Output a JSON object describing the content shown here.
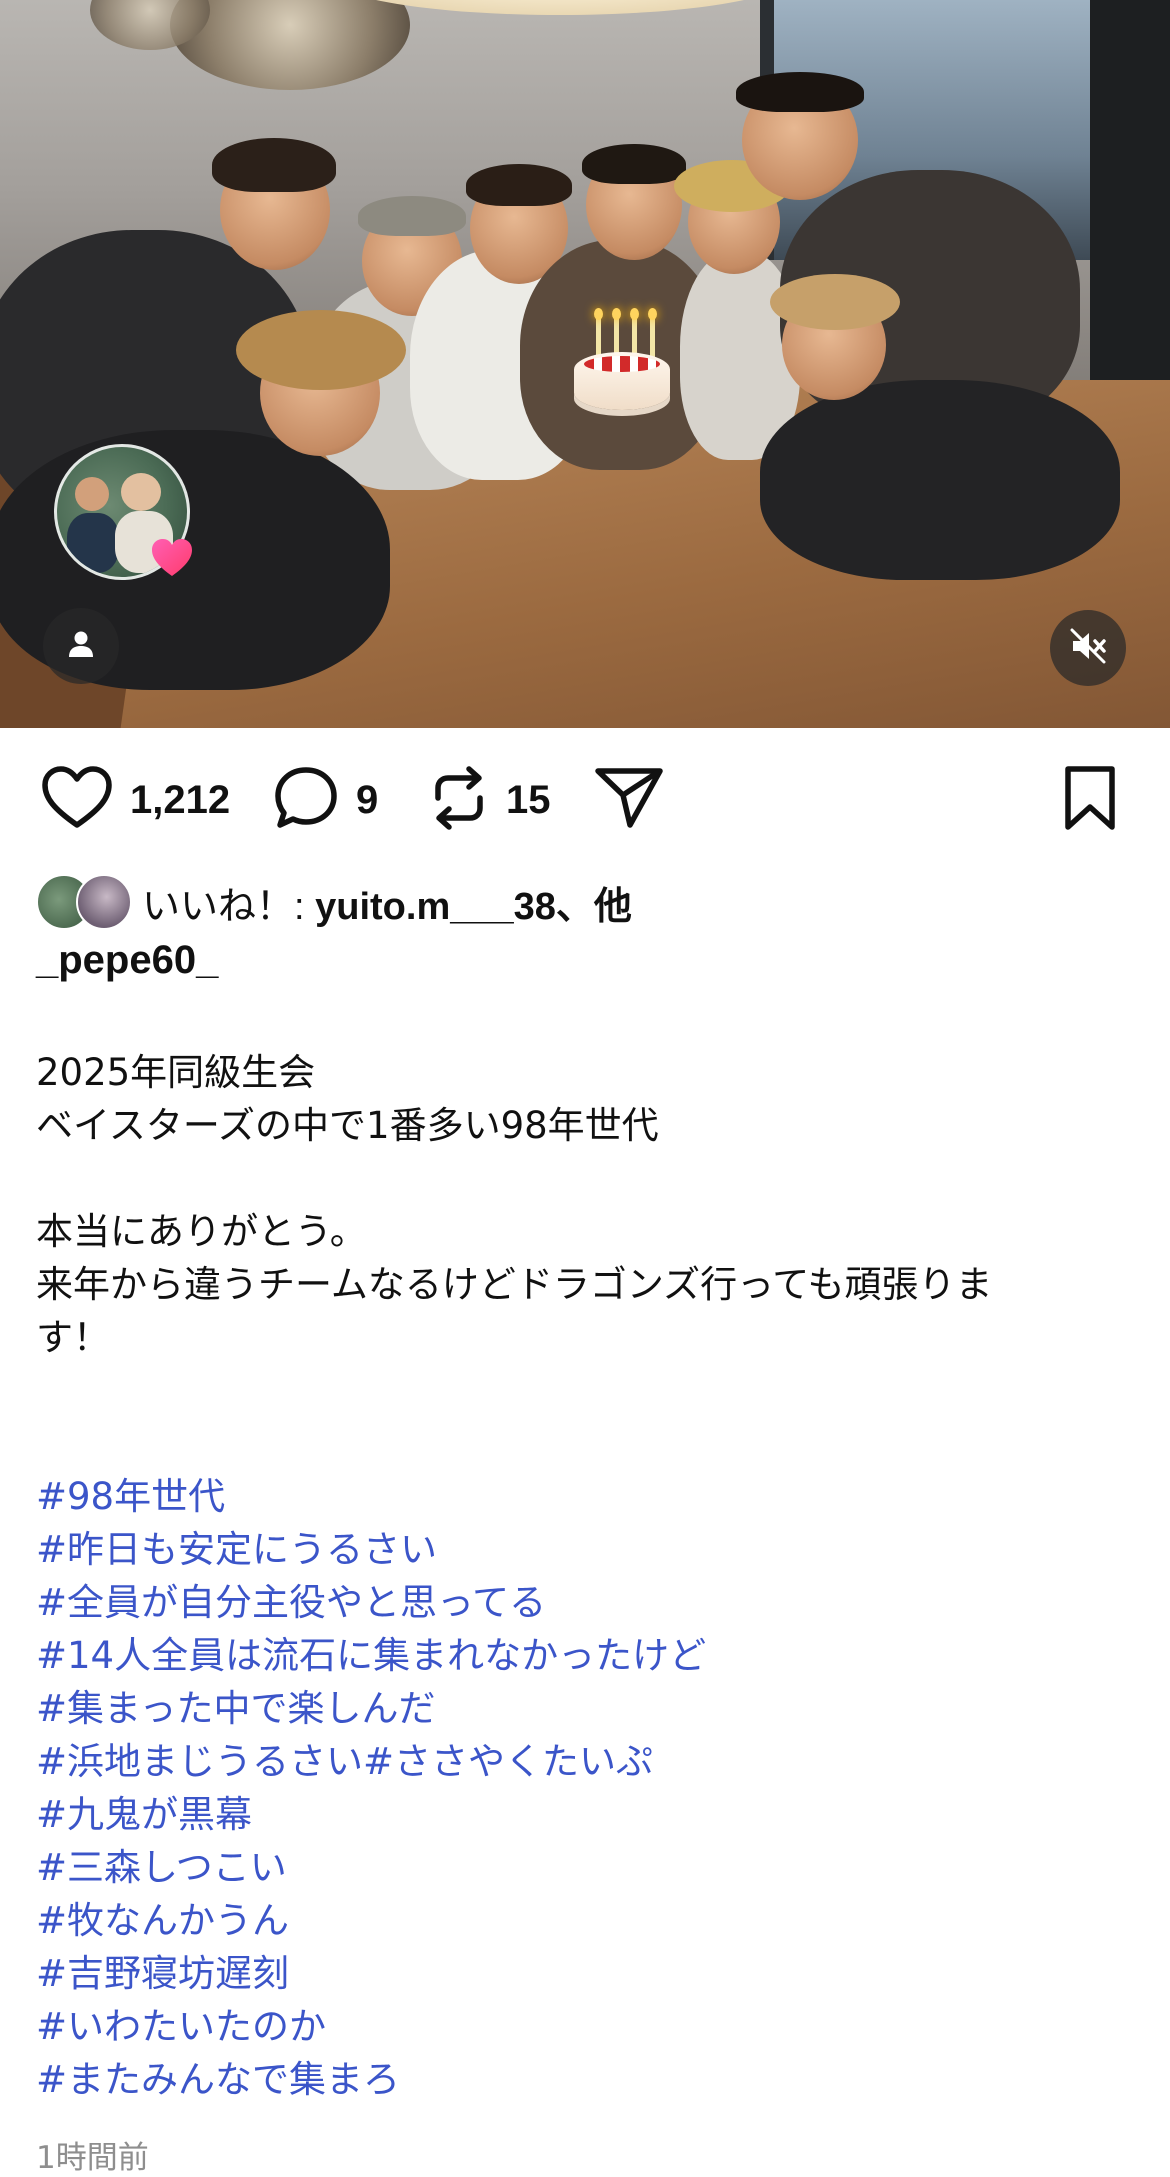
{
  "post": {
    "media": {
      "description_icon_person": "person-icon",
      "mute_icon": "speaker-muted-icon"
    },
    "actions": {
      "like_count": "1,212",
      "comment_count": "9",
      "repost_count": "15"
    },
    "likes": {
      "prefix": "いいね！: ",
      "user": "yuito.m___38",
      "suffix": "、他"
    },
    "author": "_pepe60_",
    "caption": {
      "line1": "2025年同級生会",
      "line2": "ベイスターズの中で1番多い98年世代",
      "line3": "本当にありがとう。",
      "line4": "来年から違うチームなるけどドラゴンズ行っても頑張りま",
      "line5": "す！"
    },
    "hashtags": [
      "#98年世代",
      "#昨日も安定にうるさい",
      "#全員が自分主役やと思ってる",
      "#14人全員は流石に集まれなかったけど",
      "#集まった中で楽しんだ",
      "#浜地まじうるさい#ささやくたいぷ",
      "#九鬼が黒幕",
      "#三森しつこい",
      "#牧なんかうん",
      "#吉野寝坊遅刻",
      "#いわたいたのか",
      "#またみんなで集まろ"
    ],
    "timestamp": "1時間前",
    "colors": {
      "hashtag": "#3b55c9",
      "text": "#111111",
      "muted": "#8e8e8e"
    }
  }
}
